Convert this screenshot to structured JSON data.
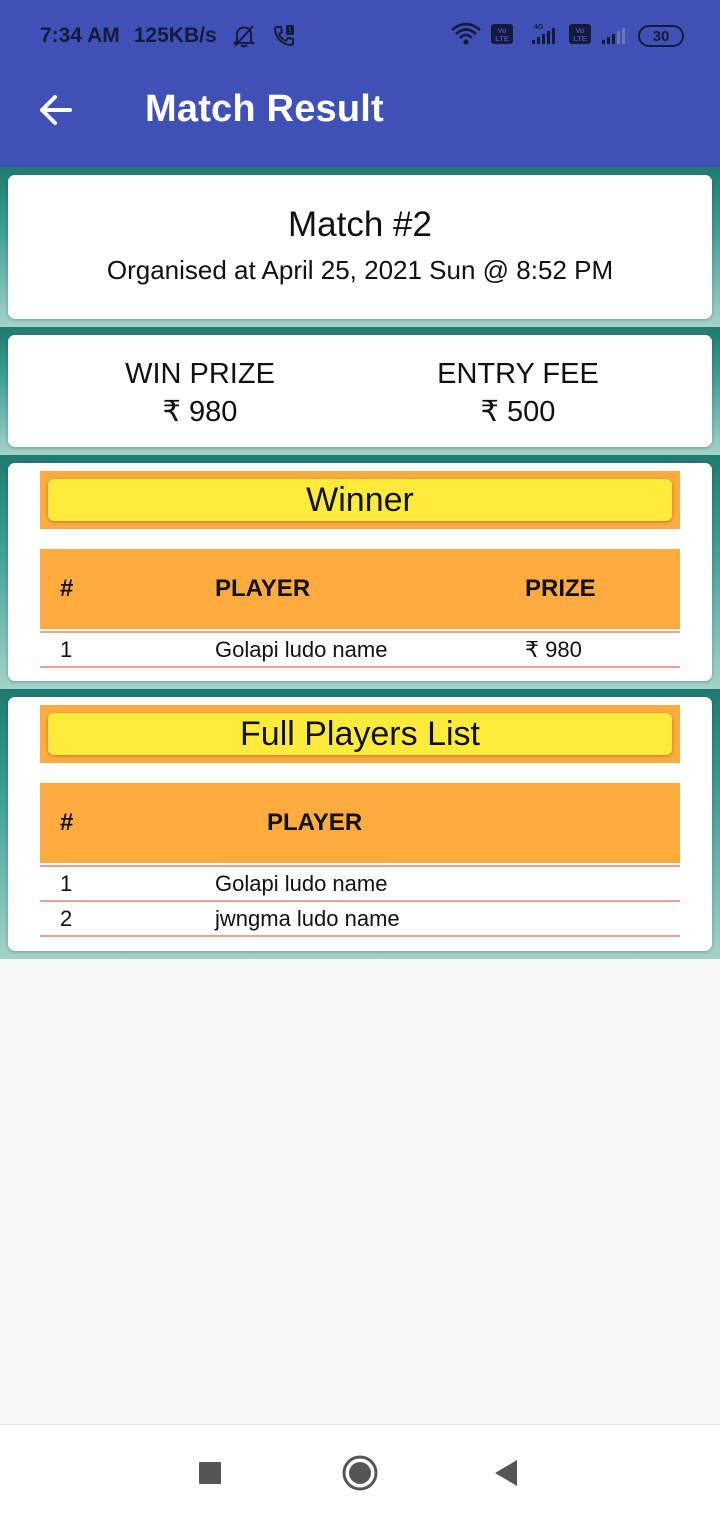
{
  "status_bar": {
    "time": "7:34 AM",
    "speed": "125KB/s",
    "battery": "30",
    "network_label": "4G",
    "volte_label": "Vo LTE",
    "icons": [
      "mute-bell-icon",
      "wifi-call-icon",
      "wifi-icon",
      "volte-icon",
      "signal-icon",
      "battery-icon"
    ]
  },
  "app_bar": {
    "title": "Match Result",
    "back_icon": "arrow-left-icon",
    "color": "#3f51b5"
  },
  "match": {
    "title": "Match #2",
    "organised": "Organised at April 25, 2021 Sun @ 8:52 PM"
  },
  "prizes": {
    "win_label": "WIN PRIZE",
    "win_value": "₹ 980",
    "entry_label": "ENTRY FEE",
    "entry_value": "₹ 500"
  },
  "winner": {
    "heading": "Winner",
    "columns": [
      "#",
      "PLAYER",
      "PRIZE"
    ],
    "rows": [
      {
        "rank": "1",
        "player": "Golapi ludo name",
        "prize": "₹ 980"
      }
    ]
  },
  "players": {
    "heading": "Full Players List",
    "columns": [
      "#",
      "PLAYER"
    ],
    "rows": [
      {
        "rank": "1",
        "player": "Golapi ludo name"
      },
      {
        "rank": "2",
        "player": "jwngma ludo name"
      }
    ]
  },
  "colors": {
    "accent_orange": "#ffab40",
    "banner_yellow": "#ffeb3b",
    "teal": "#1f7a70"
  },
  "nav_bar": {
    "icons": [
      "recents-square-icon",
      "home-circle-icon",
      "back-triangle-icon"
    ]
  }
}
